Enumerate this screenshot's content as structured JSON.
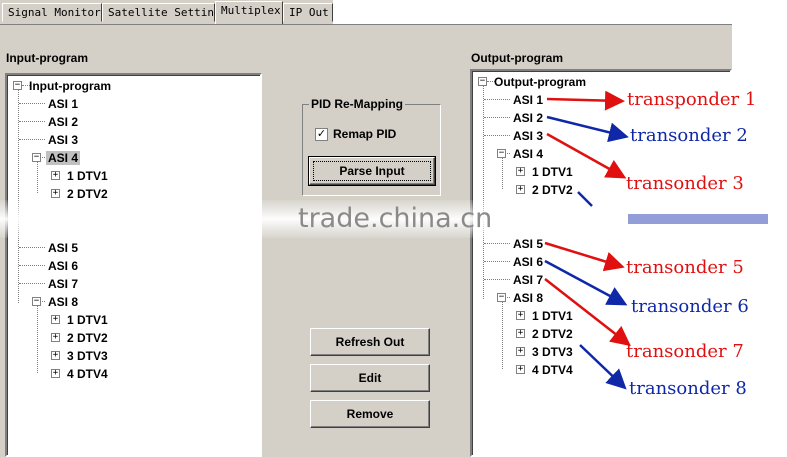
{
  "tabs": [
    {
      "label": "Signal Monitor"
    },
    {
      "label": "Satellite Setting"
    },
    {
      "label": "Multiplex"
    },
    {
      "label": "IP Out"
    }
  ],
  "input_panel": {
    "title": "Input-program",
    "root": "Input-program",
    "items": [
      "ASI 1",
      "ASI 2",
      "ASI 3",
      "ASI 4",
      "1 DTV1",
      "2 DTV2",
      "ASI 5",
      "ASI 6",
      "ASI 7",
      "ASI 8",
      "1 DTV1",
      "2 DTV2",
      "3 DTV3",
      "4 DTV4"
    ]
  },
  "output_panel": {
    "title": "Output-program",
    "root": "Output-program",
    "items": [
      "ASI 1",
      "ASI 2",
      "ASI 3",
      "ASI 4",
      "1 DTV1",
      "2 DTV2",
      "ASI 5",
      "ASI 6",
      "ASI 7",
      "ASI 8",
      "1 DTV1",
      "2 DTV2",
      "3 DTV3",
      "4 DTV4"
    ]
  },
  "remap": {
    "group_label": "PID Re-Mapping",
    "checkbox_label": "Remap PID",
    "checked": true,
    "parse_button": "Parse Input"
  },
  "buttons": {
    "refresh": "Refresh Out",
    "edit": "Edit",
    "remove": "Remove"
  },
  "annotations": [
    {
      "text": "transponder 1",
      "color": "#e01010"
    },
    {
      "text": "transonder 2",
      "color": "#1028a8"
    },
    {
      "text": "transonder 3",
      "color": "#e01010"
    },
    {
      "text": "transonder 5",
      "color": "#e01010"
    },
    {
      "text": "transonder 6",
      "color": "#1028a8"
    },
    {
      "text": "transonder 7",
      "color": "#e01010"
    },
    {
      "text": "transonder 8",
      "color": "#1028a8"
    }
  ],
  "watermark": "trade.china.cn",
  "colors": {
    "window": "#d4d0c8",
    "red_annotation": "#e01010",
    "blue_annotation": "#1028a8"
  }
}
